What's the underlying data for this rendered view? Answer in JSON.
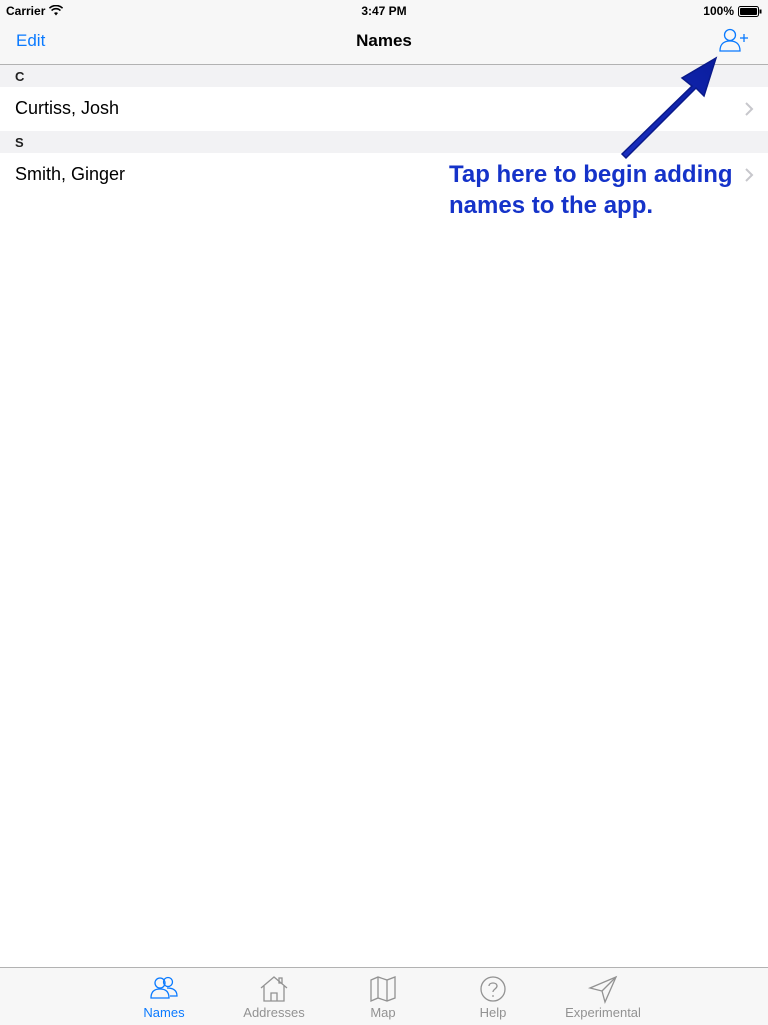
{
  "status_bar": {
    "carrier": "Carrier",
    "time": "3:47 PM",
    "battery": "100%"
  },
  "nav": {
    "edit_label": "Edit",
    "title": "Names",
    "add_icon": "add-person-icon"
  },
  "sections": [
    {
      "header": "C",
      "rows": [
        "Curtiss, Josh"
      ]
    },
    {
      "header": "S",
      "rows": [
        "Smith, Ginger"
      ]
    }
  ],
  "callout": {
    "line1": "Tap here to begin adding",
    "line2": "names to the app.",
    "color": "#1533c9"
  },
  "tabs": [
    {
      "label": "Names",
      "icon": "people-icon",
      "active": true
    },
    {
      "label": "Addresses",
      "icon": "house-icon",
      "active": false
    },
    {
      "label": "Map",
      "icon": "map-icon",
      "active": false
    },
    {
      "label": "Help",
      "icon": "question-icon",
      "active": false
    },
    {
      "label": "Experimental",
      "icon": "paper-plane-icon",
      "active": false
    }
  ],
  "colors": {
    "accent": "#0a7aff",
    "inactive": "#929292",
    "bar_bg": "#f7f7f7",
    "section_bg": "#f2f2f4"
  }
}
